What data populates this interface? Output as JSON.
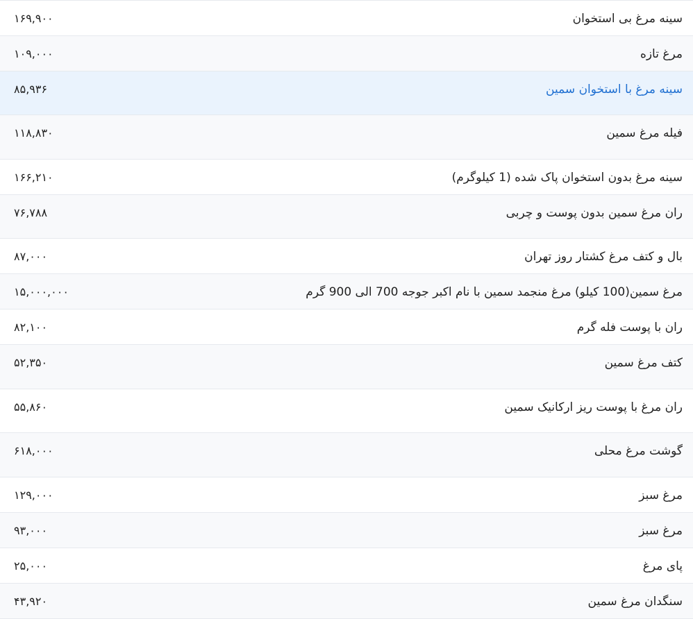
{
  "rows": [
    {
      "name": "سینه مرغ بی استخوان",
      "price": "۱۶۹,۹۰۰"
    },
    {
      "name": "مرغ تازه",
      "price": "۱۰۹,۰۰۰"
    },
    {
      "name": "سینه مرغ با استخوان سمین",
      "price": "۸۵,۹۳۶"
    },
    {
      "name": "فیله مرغ سمین",
      "price": "۱۱۸,۸۳۰"
    },
    {
      "name": "سینه مرغ بدون استخوان پاک شده (1 کیلوگرم)",
      "price": "۱۶۶,۲۱۰"
    },
    {
      "name": "ران مرغ سمین بدون پوست و چربی",
      "price": "۷۶,۷۸۸"
    },
    {
      "name": "بال و کتف مرغ کشتار روز تهران",
      "price": "۸۷,۰۰۰"
    },
    {
      "name": "مرغ سمین(100 کیلو) مرغ منجمد سمین با نام اکبر جوجه 700 الی 900 گرم",
      "price": "۱۵,۰۰۰,۰۰۰"
    },
    {
      "name": "ران با پوست فله گرم",
      "price": "۸۲,۱۰۰"
    },
    {
      "name": "کتف مرغ سمین",
      "price": "۵۲,۳۵۰"
    },
    {
      "name": "ران مرغ با پوست ریز ارکانیک سمین",
      "price": "۵۵,۸۶۰"
    },
    {
      "name": "گوشت مرغ محلی",
      "price": "۶۱۸,۰۰۰"
    },
    {
      "name": "مرغ سبز",
      "price": "۱۲۹,۰۰۰"
    },
    {
      "name": "مرغ سبز",
      "price": "۹۳,۰۰۰"
    },
    {
      "name": "پای مرغ",
      "price": "۲۵,۰۰۰"
    },
    {
      "name": "سنگدان مرغ سمین",
      "price": "۴۳,۹۲۰"
    }
  ]
}
